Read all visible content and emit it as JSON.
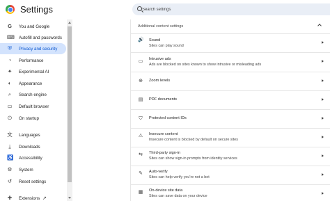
{
  "header": {
    "title": "Settings",
    "search_placeholder": "Search settings"
  },
  "sidebar": {
    "items": [
      {
        "label": "You and Google",
        "icon": "G"
      },
      {
        "label": "Autofill and passwords",
        "icon": "⌨"
      },
      {
        "label": "Privacy and security",
        "icon": "⛨",
        "active": true
      },
      {
        "label": "Performance",
        "icon": "◔"
      },
      {
        "label": "Experimental AI",
        "icon": "✦"
      },
      {
        "label": "Appearance",
        "icon": "◐"
      },
      {
        "label": "Search engine",
        "icon": "⌕"
      },
      {
        "label": "Default browser",
        "icon": "▭"
      },
      {
        "label": "On startup",
        "icon": "⏻"
      },
      {
        "label": "Languages",
        "icon": "文"
      },
      {
        "label": "Downloads",
        "icon": "⤓"
      },
      {
        "label": "Accessibility",
        "icon": "♿"
      },
      {
        "label": "System",
        "icon": "⚙"
      },
      {
        "label": "Reset settings",
        "icon": "↺"
      },
      {
        "label": "Extensions",
        "icon": "✚"
      }
    ],
    "extensions_link_icon": "open-in-new"
  },
  "content": {
    "section_title": "Additional content settings",
    "rows": [
      {
        "icon": "🔊",
        "title": "Sound",
        "subtitle": "Sites can play sound"
      },
      {
        "icon": "▭",
        "title": "Intrusive ads",
        "subtitle": "Ads are blocked on sites known to show intrusive or misleading ads"
      },
      {
        "icon": "⊕",
        "title": "Zoom levels",
        "subtitle": ""
      },
      {
        "icon": "▤",
        "title": "PDF documents",
        "subtitle": ""
      },
      {
        "icon": "⛉",
        "title": "Protected content IDs",
        "subtitle": ""
      },
      {
        "icon": "⚠",
        "title": "Insecure content",
        "subtitle": "Insecure content is blocked by default on secure sites"
      },
      {
        "icon": "⇆",
        "title": "Third-party sign-in",
        "subtitle": "Sites can show sign-in prompts from identity services"
      },
      {
        "icon": "✎",
        "title": "Auto-verify",
        "subtitle": "Sites can help verify you're not a bot"
      },
      {
        "icon": "▦",
        "title": "On-device site data",
        "subtitle": "Sites can save data on your device"
      }
    ]
  },
  "colors": {
    "accent": "#0b57d0",
    "active_bg": "#d3e3fd",
    "search_bg": "#e9eef6"
  }
}
